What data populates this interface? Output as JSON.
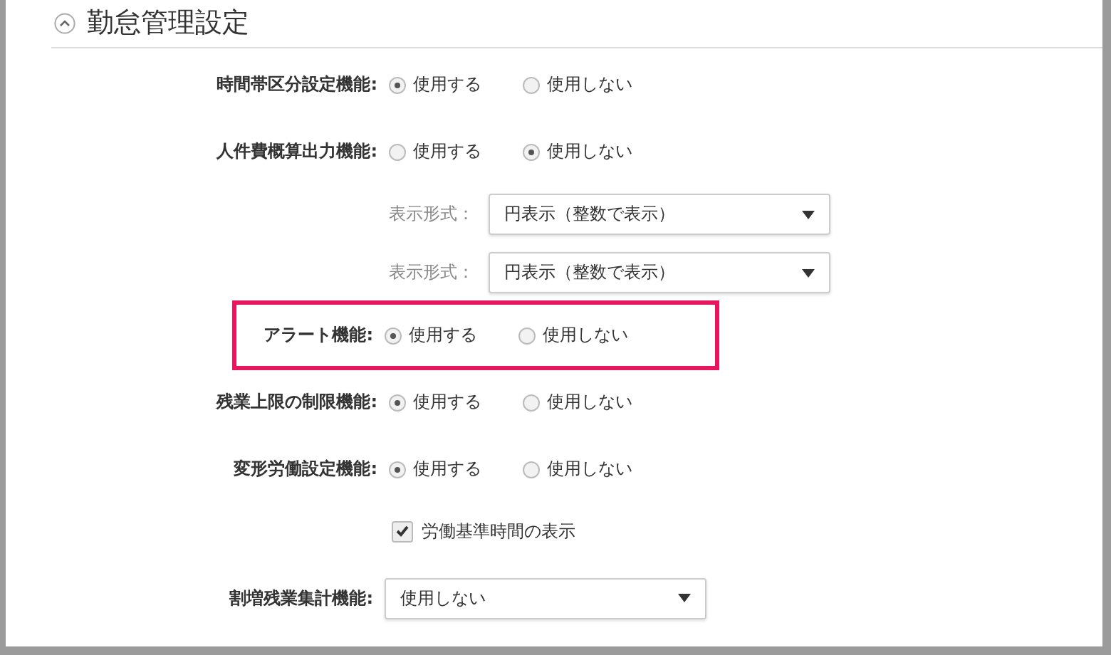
{
  "section": {
    "title": "勤怠管理設定",
    "expanded": true
  },
  "rows": [
    {
      "kind": "radio",
      "label": "時間帯区分設定機能:",
      "highlighted": false,
      "options": [
        {
          "label": "使用する",
          "selected": true
        },
        {
          "label": "使用しない",
          "selected": false
        }
      ]
    },
    {
      "kind": "radio",
      "label": "人件費概算出力機能:",
      "highlighted": false,
      "options": [
        {
          "label": "使用する",
          "selected": false
        },
        {
          "label": "使用しない",
          "selected": true
        }
      ]
    },
    {
      "kind": "subselect",
      "label": "表示形式：",
      "value": "円表示（整数で表示）"
    },
    {
      "kind": "subselect",
      "label": "表示形式：",
      "value": "円表示（整数で表示）"
    },
    {
      "kind": "radio",
      "label": "アラート機能:",
      "highlighted": true,
      "options": [
        {
          "label": "使用する",
          "selected": true
        },
        {
          "label": "使用しない",
          "selected": false
        }
      ]
    },
    {
      "kind": "radio",
      "label": "残業上限の制限機能:",
      "highlighted": false,
      "options": [
        {
          "label": "使用する",
          "selected": true
        },
        {
          "label": "使用しない",
          "selected": false
        }
      ]
    },
    {
      "kind": "radio",
      "label": "変形労働設定機能:",
      "highlighted": false,
      "options": [
        {
          "label": "使用する",
          "selected": true
        },
        {
          "label": "使用しない",
          "selected": false
        }
      ]
    },
    {
      "kind": "checkbox",
      "label": "労働基準時間の表示",
      "checked": true
    },
    {
      "kind": "select",
      "label": "割増残業集計機能:",
      "value": "使用しない"
    }
  ]
}
